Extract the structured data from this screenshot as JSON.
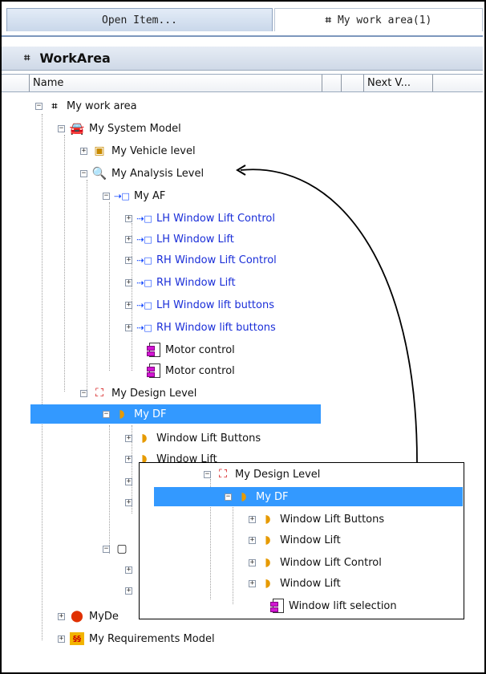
{
  "tabs": {
    "open_item": "Open Item...",
    "work_area": "My work area(1)"
  },
  "panel": {
    "title": "WorkArea"
  },
  "columns": {
    "name": "Name",
    "next": "Next V..."
  },
  "tree": {
    "root": "My work area",
    "system_model": "My System Model",
    "vehicle_level": "My Vehicle level",
    "analysis_level": "My Analysis Level",
    "af": "My AF",
    "af_items": [
      "LH Window Lift Control",
      "LH Window Lift",
      "RH Window Lift Control",
      "RH Window Lift",
      "LH Window lift buttons",
      "RH Window lift buttons"
    ],
    "motor_1": "Motor control",
    "motor_2": "Motor control",
    "design_level": "My Design Level",
    "df": "My DF",
    "df_item_1": "Window Lift Buttons",
    "df_item_2_partial": "Window Lift",
    "my_de_partial": "MyDe",
    "requirements": "My Requirements Model"
  },
  "inset": {
    "design_level": "My Design Level",
    "df": "My DF",
    "items": [
      "Window Lift Buttons",
      "Window Lift",
      "Window Lift Control",
      "Window Lift"
    ],
    "selection": "Window lift selection"
  },
  "colors": {
    "selection": "#3399ff",
    "link": "#1a2ed8"
  }
}
